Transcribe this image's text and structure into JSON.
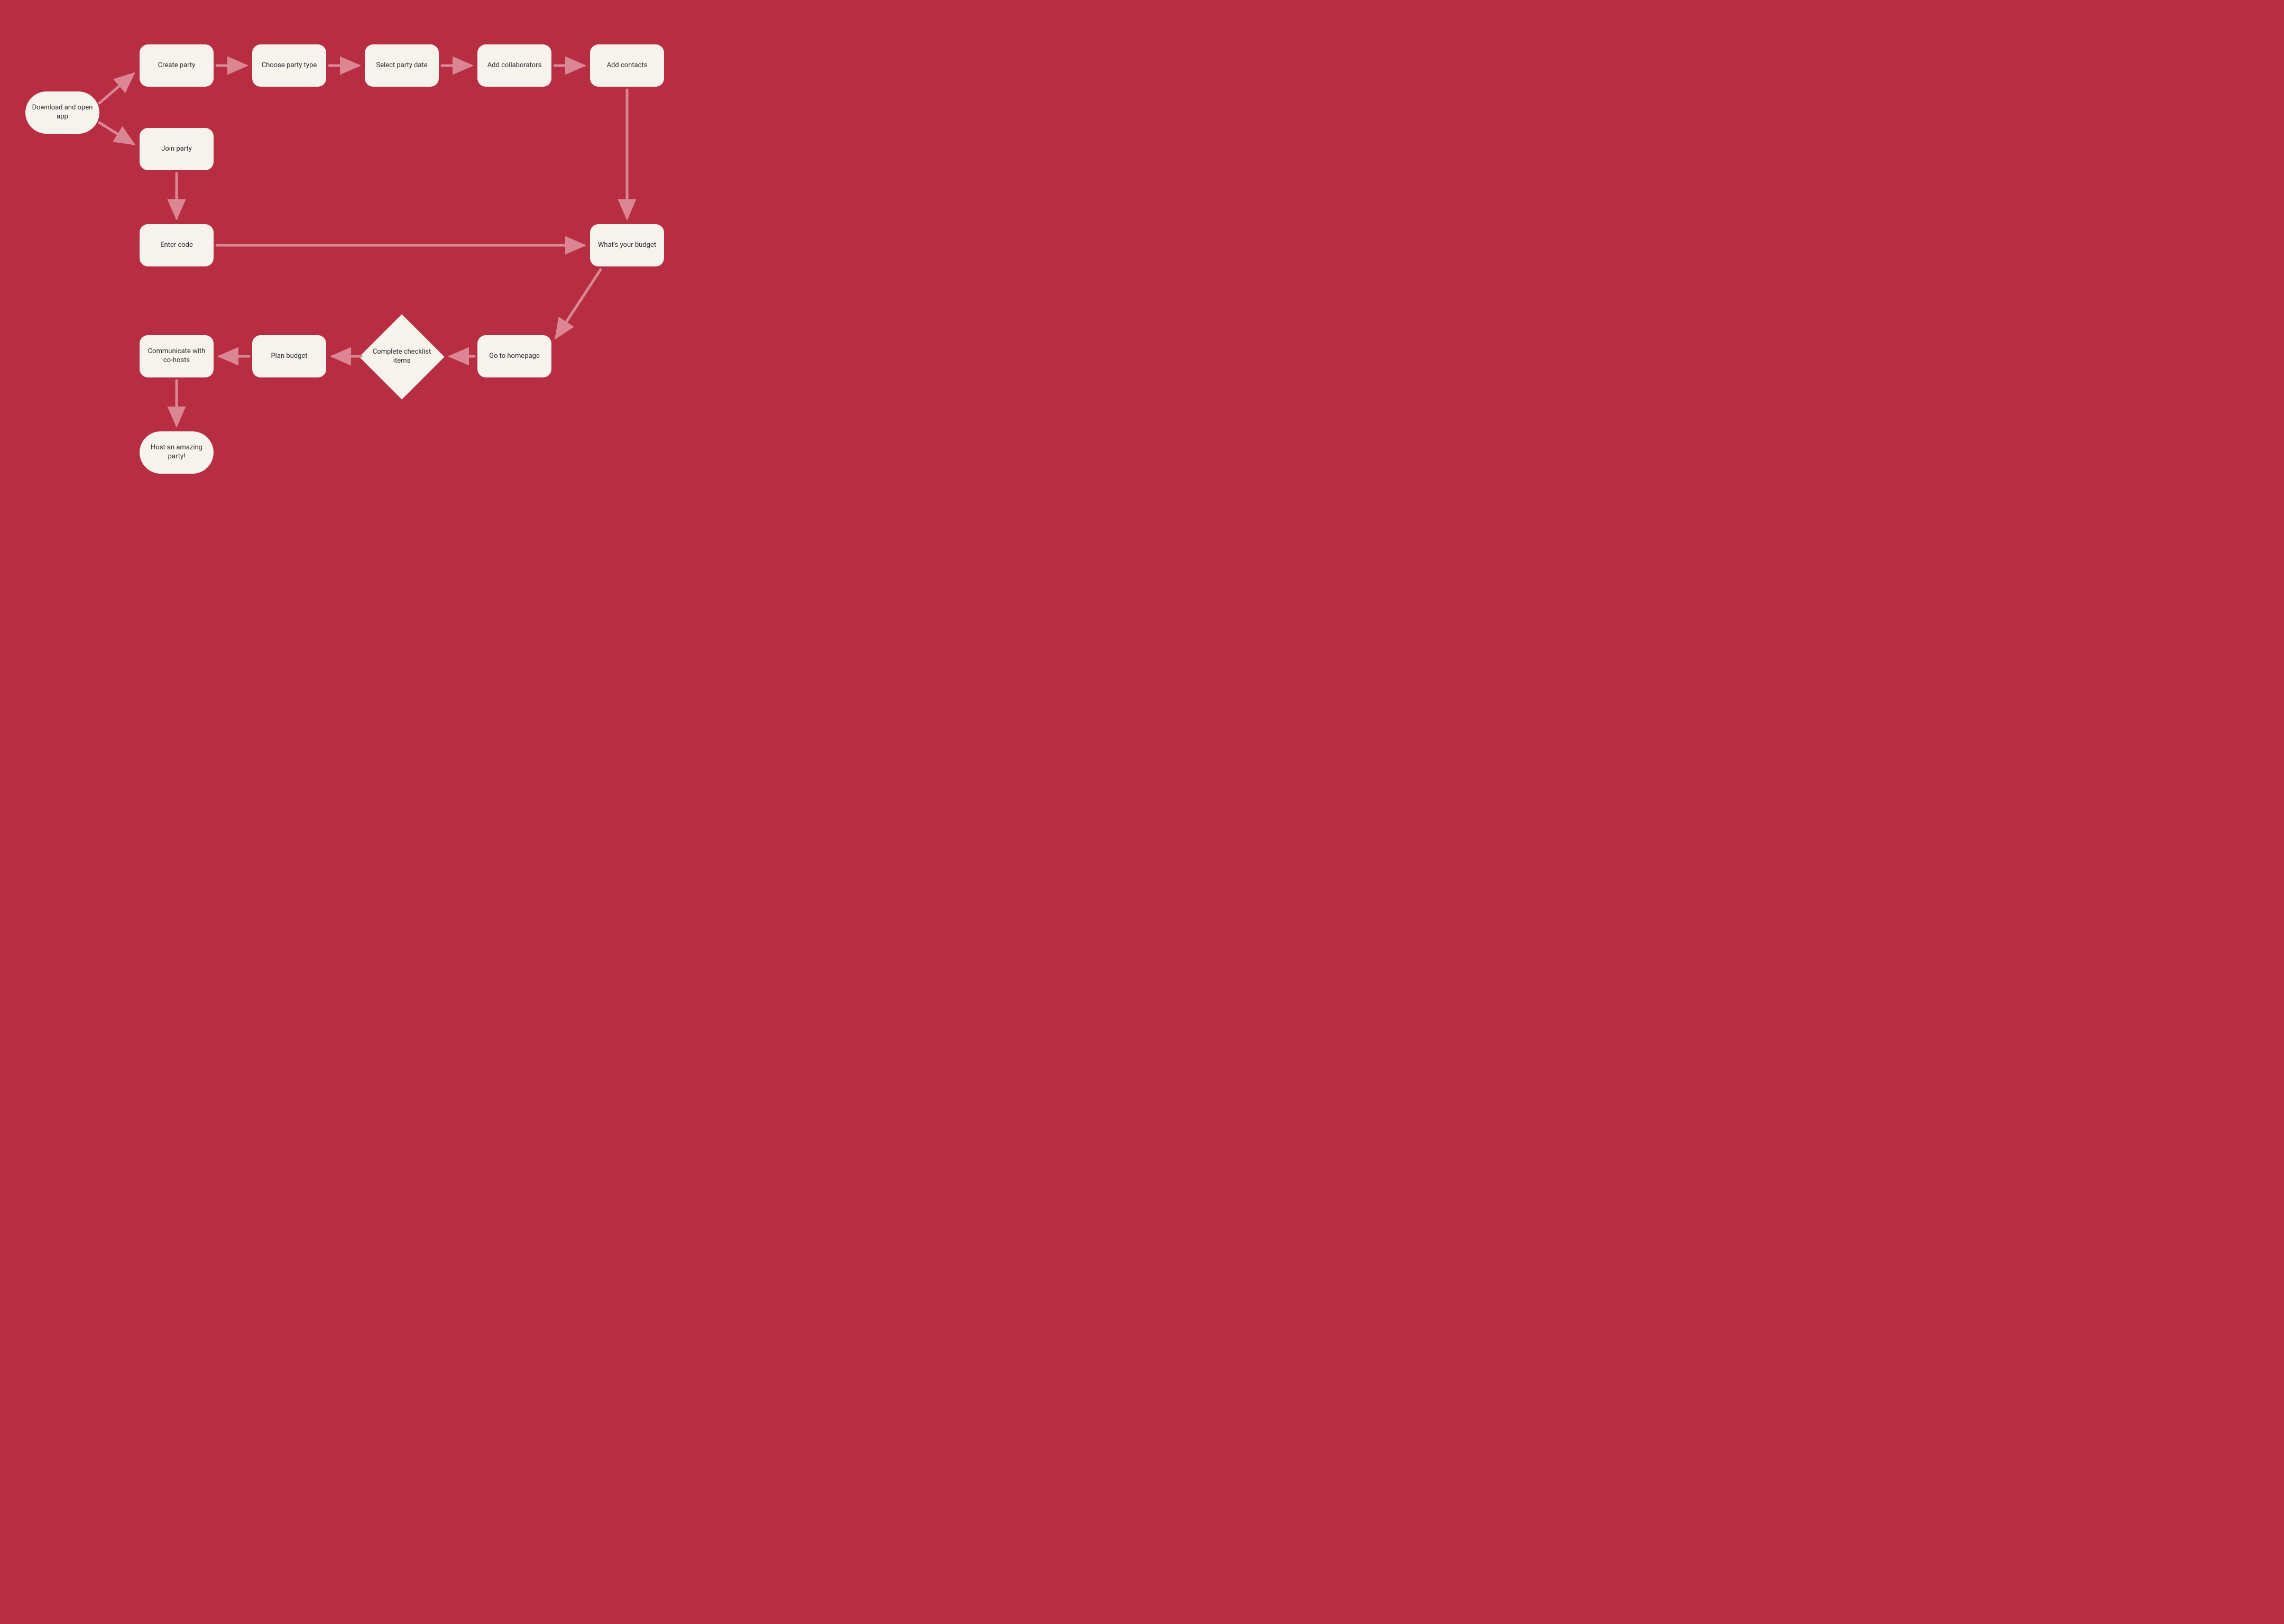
{
  "colors": {
    "background": "#b72e43",
    "node_fill": "#f6f3ec",
    "node_text": "#2a2e33",
    "arrow": "#dc8693"
  },
  "nodes": {
    "start": {
      "label": "Download and open app",
      "shape": "terminator"
    },
    "create_party": {
      "label": "Create party",
      "shape": "rect"
    },
    "join_party": {
      "label": "Join party",
      "shape": "rect"
    },
    "choose_type": {
      "label": "Choose party type",
      "shape": "rect"
    },
    "select_date": {
      "label": "Select party date",
      "shape": "rect"
    },
    "add_collab": {
      "label": "Add collaborators",
      "shape": "rect"
    },
    "add_contacts": {
      "label": "Add contacts",
      "shape": "rect"
    },
    "enter_code": {
      "label": "Enter code",
      "shape": "rect"
    },
    "budget_q": {
      "label": "What's your budget",
      "shape": "rect"
    },
    "homepage": {
      "label": "Go to homepage",
      "shape": "rect"
    },
    "checklist": {
      "label": "Complete checklist items",
      "shape": "diamond"
    },
    "plan_budget": {
      "label": "Plan budget",
      "shape": "rect"
    },
    "communicate": {
      "label": "Communicate with co-hosts",
      "shape": "rect"
    },
    "end": {
      "label": "Host an amazing party!",
      "shape": "terminator"
    }
  },
  "edges": [
    {
      "from": "start",
      "to": "create_party"
    },
    {
      "from": "start",
      "to": "join_party"
    },
    {
      "from": "create_party",
      "to": "choose_type"
    },
    {
      "from": "choose_type",
      "to": "select_date"
    },
    {
      "from": "select_date",
      "to": "add_collab"
    },
    {
      "from": "add_collab",
      "to": "add_contacts"
    },
    {
      "from": "add_contacts",
      "to": "budget_q"
    },
    {
      "from": "join_party",
      "to": "enter_code"
    },
    {
      "from": "enter_code",
      "to": "budget_q"
    },
    {
      "from": "budget_q",
      "to": "homepage"
    },
    {
      "from": "homepage",
      "to": "checklist"
    },
    {
      "from": "checklist",
      "to": "plan_budget"
    },
    {
      "from": "plan_budget",
      "to": "communicate"
    },
    {
      "from": "communicate",
      "to": "end"
    }
  ]
}
